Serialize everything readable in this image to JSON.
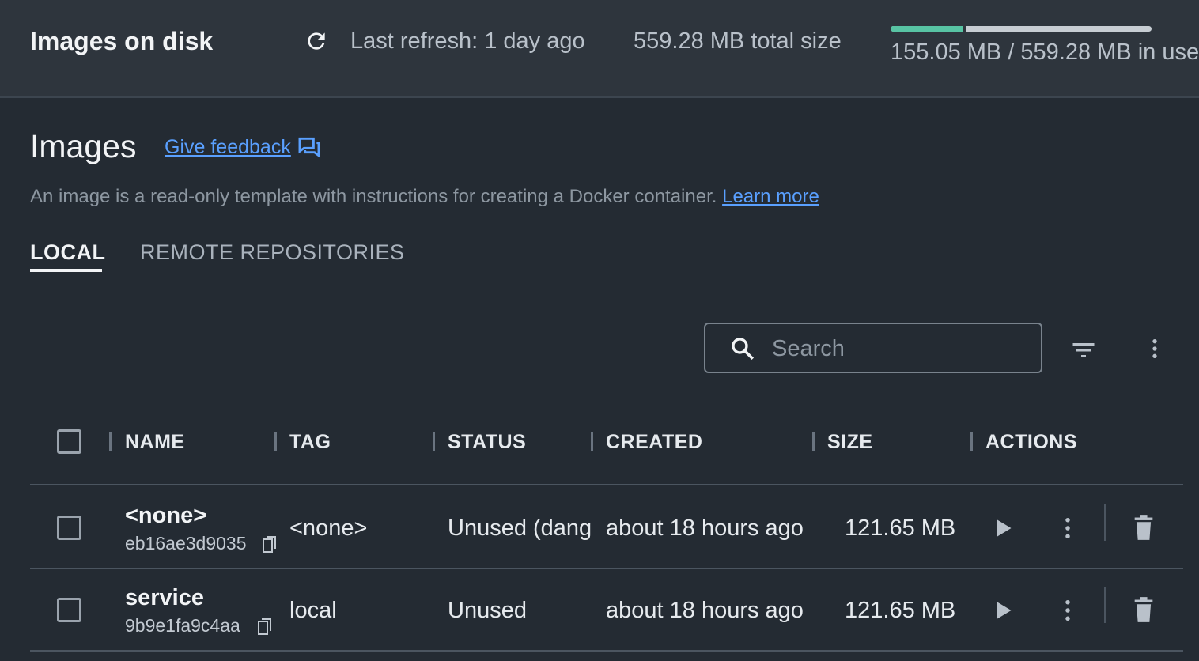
{
  "topbar": {
    "title": "Images on disk",
    "refresh_icon": "refresh-icon",
    "last_refresh": "Last refresh: 1 day ago",
    "total_size": "559.28 MB total size",
    "usage_text": "155.05 MB / 559.28 MB in use",
    "usage_fraction": 0.277
  },
  "header": {
    "title": "Images",
    "feedback_label": "Give feedback",
    "feedback_icon": "feedback-chat-icon",
    "description": "An image is a read-only template with instructions for creating a Docker container.",
    "learn_more": "Learn more"
  },
  "tabs": [
    {
      "label": "LOCAL",
      "active": true
    },
    {
      "label": "REMOTE REPOSITORIES",
      "active": false
    }
  ],
  "toolbar": {
    "search_placeholder": "Search",
    "filter_icon": "filter-icon",
    "more_icon": "more-vert-icon"
  },
  "table": {
    "columns": [
      "NAME",
      "TAG",
      "STATUS",
      "CREATED",
      "SIZE",
      "ACTIONS"
    ],
    "rows": [
      {
        "name": "<none>",
        "id": "eb16ae3d9035",
        "tag": "<none>",
        "status": "Unused (dang",
        "created": "about 18 hours ago",
        "size": "121.65 MB"
      },
      {
        "name": "service",
        "id": "9b9e1fa9c4aa",
        "tag": "local",
        "status": "Unused",
        "created": "about 18 hours ago",
        "size": "121.65 MB"
      }
    ]
  },
  "colors": {
    "accent_link": "#5aa0ff",
    "usage_green": "#58c4a4",
    "background": "#242b33"
  }
}
